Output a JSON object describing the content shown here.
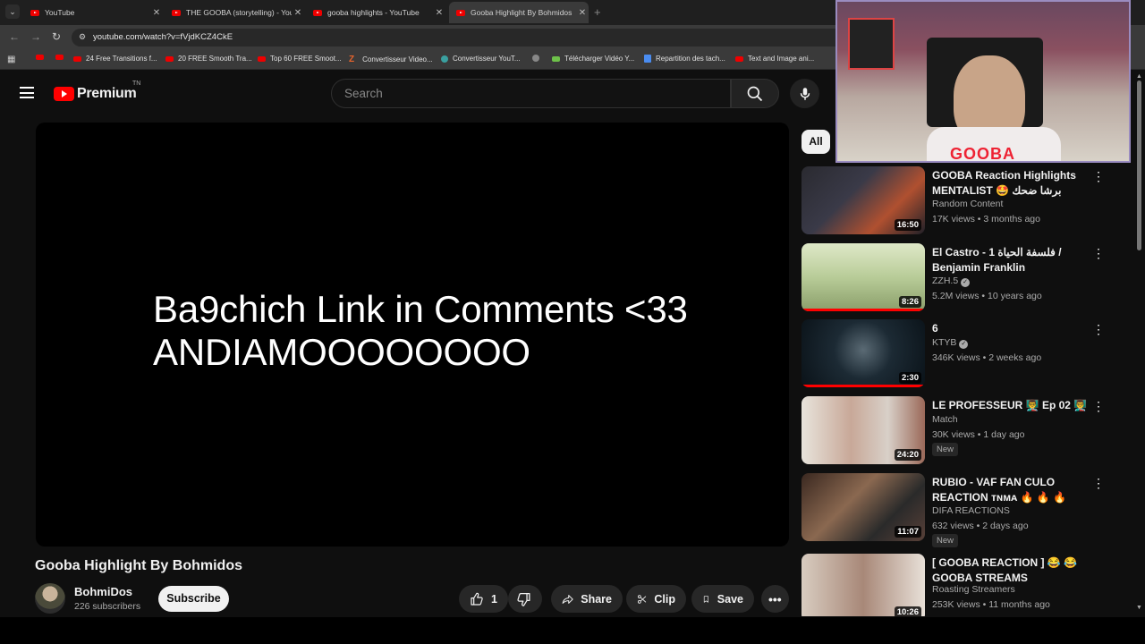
{
  "browser": {
    "tabs": [
      {
        "title": "YouTube",
        "active": false
      },
      {
        "title": "THE GOOBA (storytelling) - You",
        "active": false
      },
      {
        "title": "gooba highlights - YouTube",
        "active": false
      },
      {
        "title": "Gooba Highlight By Bohmidos",
        "active": true
      }
    ],
    "url": "youtube.com/watch?v=fVjdKCZ4CkE",
    "bookmarks": [
      {
        "label": "",
        "icon": "youtube"
      },
      {
        "label": "",
        "icon": "youtube"
      },
      {
        "label": "24 Free Transitions f...",
        "icon": "youtube"
      },
      {
        "label": "20 FREE Smooth Tra...",
        "icon": "youtube"
      },
      {
        "label": "Top 60 FREE Smoot...",
        "icon": "youtube"
      },
      {
        "label": "Convertisseur Video...",
        "icon": "z"
      },
      {
        "label": "Convertisseur YouT...",
        "icon": "convert"
      },
      {
        "label": "",
        "icon": "circle"
      },
      {
        "label": "Télécharger Vidéo Y...",
        "icon": "download"
      },
      {
        "label": "Repartition des tach...",
        "icon": "docs"
      },
      {
        "label": "Text and Image ani...",
        "icon": "youtube"
      }
    ]
  },
  "header": {
    "logo": "Premium",
    "logo_sup": "TN",
    "search_placeholder": "Search"
  },
  "player": {
    "overlay_line1": "Ba9chich Link in Comments <33",
    "overlay_line2": "ANDIAMOOOOOOOO"
  },
  "video": {
    "title": "Gooba Highlight By Bohmidos",
    "channel": "BohmiDos",
    "subscribers": "226 subscribers",
    "subscribe_label": "Subscribe",
    "likes": "1",
    "share_label": "Share",
    "clip_label": "Clip",
    "save_label": "Save"
  },
  "chips": {
    "all": "All"
  },
  "recommendations": [
    {
      "title": "GOOBA Reaction Highlights MENTALIST 🤩 برشا ضحك",
      "channel": "Random Content",
      "meta": "17K views • 3 months ago",
      "duration": "16:50",
      "verified": false,
      "badge": "",
      "progress": 0
    },
    {
      "title": "El Castro - 1 فلسفة الحياة / Benjamin Franklin",
      "channel": "ZZH.5",
      "meta": "5.2M views • 10 years ago",
      "duration": "8:26",
      "verified": true,
      "badge": "",
      "progress": 1
    },
    {
      "title": "6",
      "channel": "KTYB",
      "meta": "346K views • 2 weeks ago",
      "duration": "2:30",
      "verified": true,
      "badge": "",
      "progress": 1
    },
    {
      "title": "LE PROFESSEUR 👨‍🏫 Ep 02 👨‍🏫",
      "channel": "Match",
      "meta": "30K views • 1 day ago",
      "duration": "24:20",
      "verified": false,
      "badge": "New",
      "progress": 0
    },
    {
      "title": "RUBIO - VAF FAN CULO REACTION ᴛɴᴍᴀ 🔥 🔥 🔥",
      "channel": "DIFA REACTIONS",
      "meta": "632 views • 2 days ago",
      "duration": "11:07",
      "verified": false,
      "badge": "New",
      "progress": 0
    },
    {
      "title": "[ GOOBA REACTION ] 😂 😂 GOOBA STREAMS HIGHLIGHT...",
      "channel": "Roasting Streamers",
      "meta": "253K views • 11 months ago",
      "duration": "10:26",
      "verified": false,
      "badge": "",
      "progress": 0
    }
  ],
  "webcam": {
    "brand": "GOOBA"
  },
  "colors": {
    "background": "#0f0f0f",
    "accent": "#ff0000",
    "surface": "#272727"
  }
}
